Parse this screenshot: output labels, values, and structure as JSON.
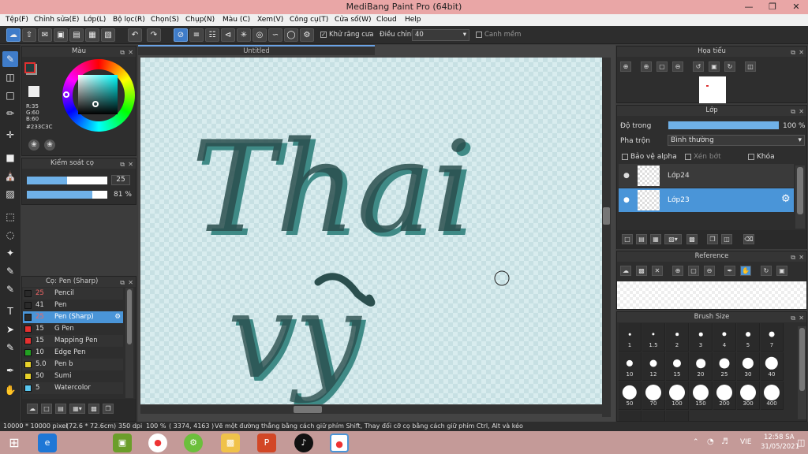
{
  "window": {
    "title": "MediBang Paint Pro (64bit)"
  },
  "menu": [
    "Tệp(F)",
    "Chỉnh sửa(E)",
    "Lớp(L)",
    "Bộ lọc(R)",
    "Chọn(S)",
    "Chụp(N)",
    "Màu (C)",
    "Xem(V)",
    "Công cụ(T)",
    "Cửa số(W)",
    "Cloud",
    "Help"
  ],
  "toolbar": {
    "antialias_label": "Khử răng cưa",
    "adjust_label": "Điều chỉnh",
    "adjust_value": "40",
    "edge_label": "Canh mềm"
  },
  "color_panel": {
    "title": "Màu",
    "r": "R:35",
    "g": "G:60",
    "b": "B:60",
    "hex": "#233C3C",
    "fg_color": "#233c3c",
    "bg_color": "#7fa89a"
  },
  "brush_control": {
    "title": "Kiểm soát cọ",
    "size_value": "25",
    "size_fraction": 0.5,
    "opacity_value": "81",
    "opacity_unit": "%",
    "opacity_fraction": 0.81
  },
  "brush_list": {
    "title": "Cọ: Pen (Sharp)",
    "items": [
      {
        "size": "25",
        "name": "Pencil",
        "color": "#2a2a2a"
      },
      {
        "size": "41",
        "name": "Pen",
        "color": "#2a2a2a"
      },
      {
        "size": "25",
        "name": "Pen (Sharp)",
        "color": "#2a2a2a"
      },
      {
        "size": "15",
        "name": "G Pen",
        "color": "#e53030"
      },
      {
        "size": "15",
        "name": "Mapping Pen",
        "color": "#e53030"
      },
      {
        "size": "10",
        "name": "Edge Pen",
        "color": "#22a022"
      },
      {
        "size": "5.0",
        "name": "Pen b",
        "color": "#e8d22a"
      },
      {
        "size": "50",
        "name": "Sumi",
        "color": "#e8d22a"
      },
      {
        "size": "5",
        "name": "Watercolor",
        "color": "#5ac8f0"
      }
    ]
  },
  "canvas": {
    "tab_title": "Untitled",
    "lettering": [
      "Thai",
      "vy"
    ]
  },
  "navigator": {
    "title": "Họa tiểu"
  },
  "layers": {
    "title": "Lớp",
    "opacity_label": "Độ trong",
    "opacity_value": "100 %",
    "blend_label": "Pha trộn",
    "blend_value": "Bình thường",
    "protect_alpha": "Bảo vệ alpha",
    "clipping": "Xén bớt",
    "lock": "Khóa",
    "items": [
      {
        "name": "Lớp24",
        "selected": false
      },
      {
        "name": "Lớp23",
        "selected": true
      }
    ]
  },
  "reference": {
    "title": "Reference"
  },
  "brush_size": {
    "title": "Brush Size",
    "sizes": [
      "1",
      "1.5",
      "2",
      "3",
      "4",
      "5",
      "7",
      "10",
      "12",
      "15",
      "20",
      "25",
      "30",
      "40",
      "50",
      "70",
      "100",
      "150",
      "200",
      "300",
      "400"
    ]
  },
  "status": {
    "doc_size": "10000 * 10000 pixel",
    "physical": "(72.6 * 72.6cm)",
    "dpi": "350 dpi",
    "zoom": "100 %",
    "coords": "( 3374, 4163 )",
    "hint": "Vẽ một đường thẳng bằng cách giữ phím Shift, Thay đổi cỡ cọ bằng cách giữ phím Ctrl, Alt và kéo"
  },
  "taskbar": {
    "lang": "VIE",
    "time": "12:58 SA",
    "date": "31/05/2021"
  }
}
